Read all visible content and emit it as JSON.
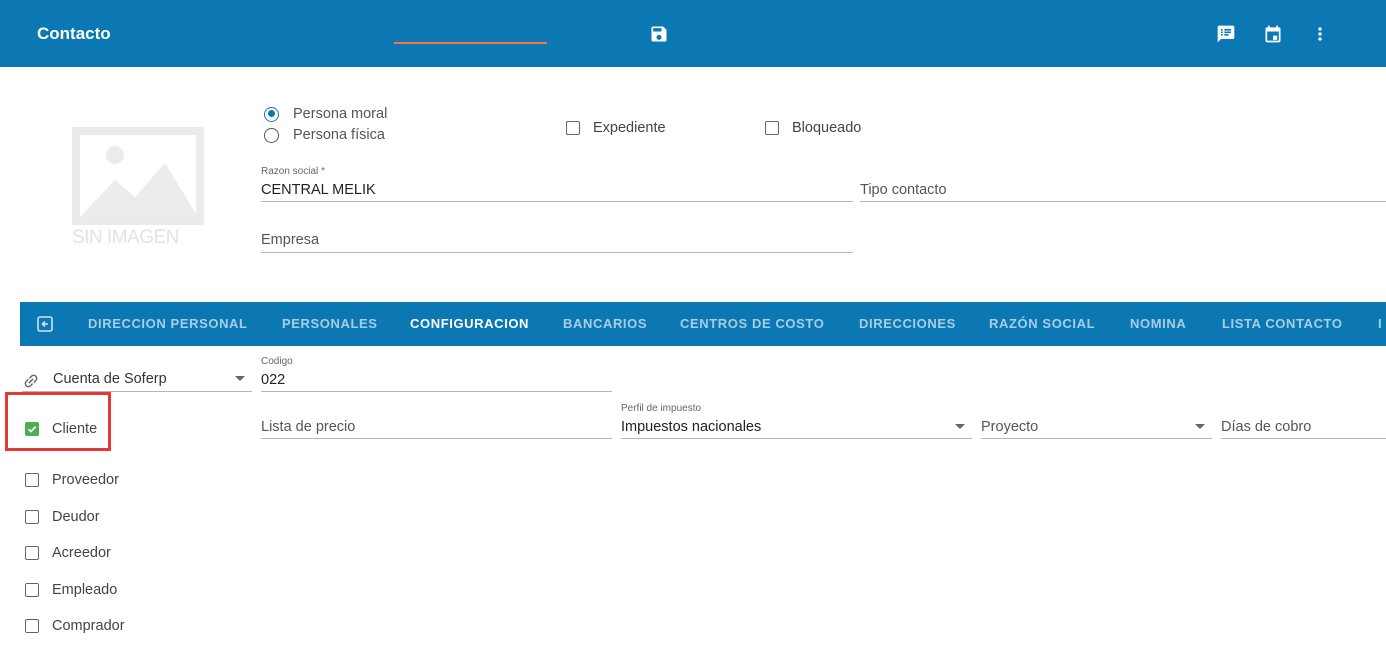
{
  "app": {
    "title": "Contacto",
    "icons": [
      "save-icon",
      "comment-icon",
      "calendar-icon",
      "more-vert-icon"
    ]
  },
  "avatar": {
    "placeholder_text": "SIN IMAGEN"
  },
  "person_type": {
    "options": [
      {
        "label": "Persona moral",
        "selected": true
      },
      {
        "label": "Persona física",
        "selected": false
      }
    ]
  },
  "flags": {
    "expediente": {
      "label": "Expediente",
      "checked": false
    },
    "bloqueado": {
      "label": "Bloqueado",
      "checked": false
    }
  },
  "form": {
    "razon_social": {
      "label": "Razon social *",
      "value": "CENTRAL MELIK"
    },
    "tipo_contacto": {
      "placeholder": "Tipo contacto"
    },
    "empresa": {
      "placeholder": "Empresa"
    }
  },
  "tabs": [
    {
      "label": "DIRECCION PERSONAL",
      "active": false
    },
    {
      "label": "PERSONALES",
      "active": false
    },
    {
      "label": "CONFIGURACION",
      "active": true
    },
    {
      "label": "BANCARIOS",
      "active": false
    },
    {
      "label": "CENTROS DE COSTO",
      "active": false
    },
    {
      "label": "DIRECCIONES",
      "active": false
    },
    {
      "label": "RAZÓN SOCIAL",
      "active": false
    },
    {
      "label": "NOMINA",
      "active": false
    },
    {
      "label": "LISTA CONTACTO",
      "active": false
    },
    {
      "label": "I",
      "active": false
    }
  ],
  "config": {
    "cuenta": {
      "value": "Cuenta de Soferp"
    },
    "codigo": {
      "label": "Codigo",
      "value": "022"
    },
    "lista_precio": {
      "placeholder": "Lista de precio"
    },
    "perfil_impuesto": {
      "label": "Perfil de impuesto",
      "value": "Impuestos nacionales"
    },
    "proyecto": {
      "placeholder": "Proyecto"
    },
    "dias_cobro": {
      "placeholder": "Días de cobro"
    },
    "roles": [
      {
        "label": "Cliente",
        "checked": true
      },
      {
        "label": "Proveedor",
        "checked": false
      },
      {
        "label": "Deudor",
        "checked": false
      },
      {
        "label": "Acreedor",
        "checked": false
      },
      {
        "label": "Empleado",
        "checked": false
      },
      {
        "label": "Comprador",
        "checked": false
      }
    ]
  },
  "colors": {
    "primary": "#0b78b4",
    "tab_indicator": "#ff6f4d",
    "check_green": "#4caf50",
    "highlight_red": "#e53935"
  }
}
